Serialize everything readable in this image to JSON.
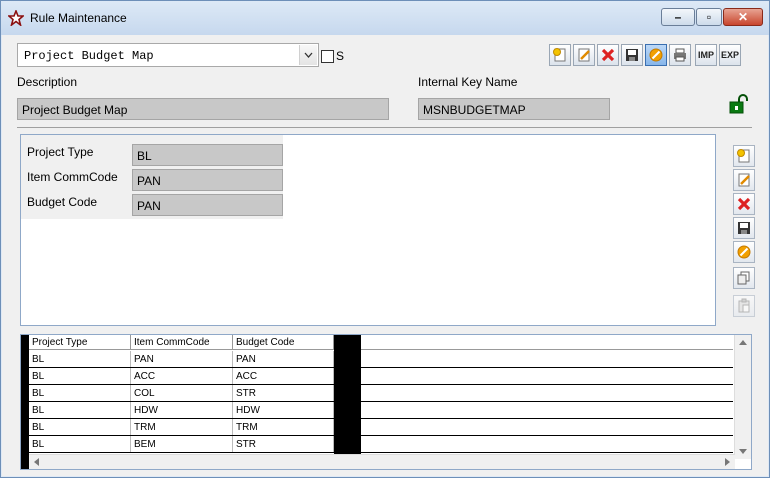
{
  "window": {
    "title": "Rule Maintenance"
  },
  "toolbar": {
    "rule_select": {
      "value": "Project Budget Map"
    },
    "checkbox_label": "S",
    "imp_label": "IMP",
    "exp_label": "EXP"
  },
  "form": {
    "description_label": "Description",
    "description_value": "Project Budget Map",
    "internal_key_label": "Internal Key Name",
    "internal_key_value": "MSNBUDGETMAP"
  },
  "detail": {
    "fields": [
      {
        "label": "Project Type",
        "value": "BL"
      },
      {
        "label": "Item CommCode",
        "value": "PAN"
      },
      {
        "label": "Budget Code",
        "value": "PAN"
      }
    ]
  },
  "grid": {
    "headers": [
      "Project Type",
      "Item CommCode",
      "Budget Code"
    ],
    "rows": [
      [
        "BL",
        "PAN",
        "PAN"
      ],
      [
        "BL",
        "ACC",
        "ACC"
      ],
      [
        "BL",
        "COL",
        "STR"
      ],
      [
        "BL",
        "HDW",
        "HDW"
      ],
      [
        "BL",
        "TRM",
        "TRM"
      ],
      [
        "BL",
        "BEM",
        "STR"
      ]
    ]
  }
}
